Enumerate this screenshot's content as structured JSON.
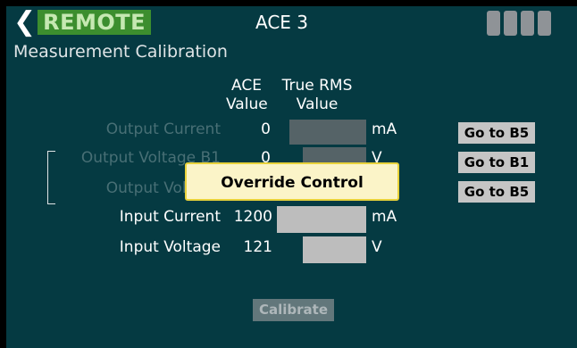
{
  "header": {
    "back_icon": "chevron-left-icon",
    "remote_label": "REMOTE",
    "device_name": "ACE 3",
    "status_indicator_count": 4
  },
  "page": {
    "subtitle": "Measurement Calibration"
  },
  "columns": {
    "ace_line1": "ACE",
    "ace_line2": "Value",
    "rms_line1": "True RMS",
    "rms_line2": "Value"
  },
  "rows": [
    {
      "label": "Output Current",
      "ace_value": "0",
      "unit": "mA",
      "goto": "Go to B5",
      "enabled": false
    },
    {
      "label": "Output Voltage B1",
      "ace_value": "0",
      "unit": "V",
      "goto": "Go to B1",
      "enabled": false
    },
    {
      "label": "Output Voltage",
      "ace_value": "",
      "unit": "",
      "goto": "Go to B5",
      "enabled": false
    },
    {
      "label": "Input Current",
      "ace_value": "1200",
      "unit": "mA",
      "enabled": true
    },
    {
      "label": "Input Voltage",
      "ace_value": "121",
      "unit": "V",
      "enabled": true
    }
  ],
  "dialog": {
    "label": "Override Control"
  },
  "actions": {
    "calibrate_label": "Calibrate"
  },
  "colors": {
    "background": "#053a42",
    "remote_green": "#3c8e2e",
    "dialog_bg": "#fbf4c8",
    "dialog_border": "#e8d23b"
  }
}
